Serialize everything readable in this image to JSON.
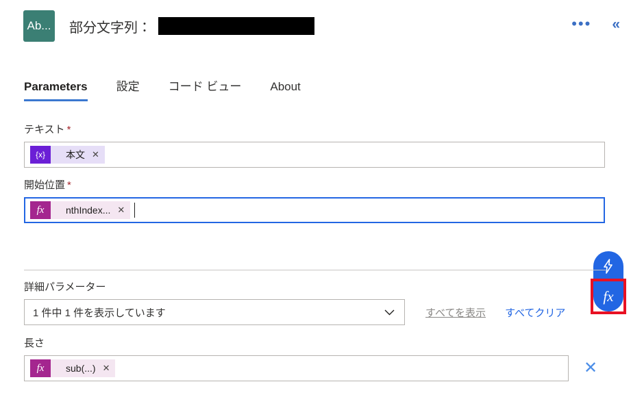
{
  "header": {
    "app_icon_label": "Ab...",
    "app_icon_color": "#3B7F74",
    "title": "部分文字列：",
    "redacted": true,
    "more_options_icon": "ellipsis-icon",
    "collapse_icon": "chevron-double-left-icon",
    "accent_color": "#3B6FC4"
  },
  "tabs": [
    {
      "label": "Parameters",
      "active": true
    },
    {
      "label": "設定",
      "active": false
    },
    {
      "label": "コード ビュー",
      "active": false
    },
    {
      "label": "About",
      "active": false
    }
  ],
  "tab_underline_color": "#3B78D0",
  "fields": [
    {
      "label": "テキスト",
      "required": true,
      "required_marker": "*",
      "focused": false,
      "chip": {
        "kind": "variable",
        "icon_glyph": "{x}",
        "icon_color": "#6B1FD6",
        "body_color": "#E6DEF7",
        "text": "本文",
        "remove_glyph": "✕"
      }
    },
    {
      "label": "開始位置",
      "required": true,
      "required_marker": "*",
      "focused": true,
      "focus_color": "#2266E3",
      "chip": {
        "kind": "expression",
        "icon_glyph": "fx",
        "icon_color": "#A4268F",
        "body_color": "#F4E6F1",
        "text": "nthIndex...",
        "remove_glyph": "✕"
      }
    }
  ],
  "float_buttons": [
    {
      "name": "dynamic-content",
      "glyph": "⚡",
      "color": "#2266E3",
      "highlighted": false
    },
    {
      "name": "expression",
      "glyph": "fx",
      "color": "#2266E3",
      "highlighted": true,
      "highlight_color": "#E81123"
    }
  ],
  "advanced": {
    "label": "詳細パラメーター",
    "select_value": "1 件中 1 件を表示しています",
    "chevron_glyph": "⌄",
    "show_all_label": "すべてを表示",
    "clear_all_label": "すべてクリア",
    "show_all_color": "#8a8886",
    "clear_all_color": "#2266E3"
  },
  "last_field": {
    "label": "長さ",
    "required": false,
    "chip": {
      "kind": "expression",
      "icon_glyph": "fx",
      "icon_color": "#A4268F",
      "body_color": "#F4E6F1",
      "text": "sub(...)",
      "remove_glyph": "✕"
    },
    "delete_glyph": "✕",
    "delete_color": "#4C8EE8"
  }
}
